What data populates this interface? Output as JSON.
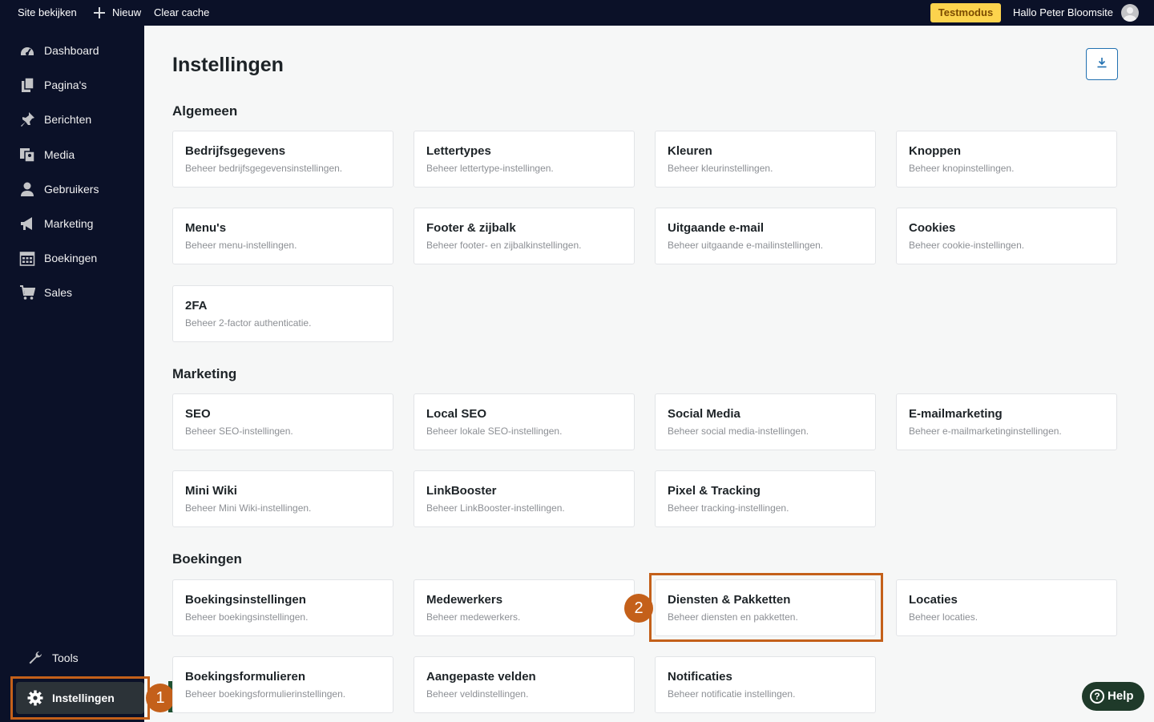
{
  "topbar": {
    "view_site": "Site bekijken",
    "new_label": "Nieuw",
    "clear_cache": "Clear cache",
    "test_mode": "Testmodus",
    "greeting": "Hallo Peter Bloomsite"
  },
  "sidebar": {
    "items": [
      {
        "label": "Dashboard",
        "icon": "dashboard-icon"
      },
      {
        "label": "Pagina's",
        "icon": "pages-icon"
      },
      {
        "label": "Berichten",
        "icon": "pin-icon"
      },
      {
        "label": "Media",
        "icon": "media-icon"
      },
      {
        "label": "Gebruikers",
        "icon": "user-icon"
      },
      {
        "label": "Marketing",
        "icon": "megaphone-icon"
      },
      {
        "label": "Boekingen",
        "icon": "calendar-icon"
      },
      {
        "label": "Sales",
        "icon": "cart-icon"
      }
    ],
    "tools": "Tools",
    "settings": "Instellingen"
  },
  "page": {
    "title": "Instellingen",
    "sections": [
      {
        "title": "Algemeen",
        "cards": [
          {
            "title": "Bedrijfsgegevens",
            "desc": "Beheer bedrijfsgegevensinstellingen."
          },
          {
            "title": "Lettertypes",
            "desc": "Beheer lettertype-instellingen."
          },
          {
            "title": "Kleuren",
            "desc": "Beheer kleurinstellingen."
          },
          {
            "title": "Knoppen",
            "desc": "Beheer knopinstellingen."
          },
          {
            "title": "Menu's",
            "desc": "Beheer menu-instellingen."
          },
          {
            "title": "Footer & zijbalk",
            "desc": "Beheer footer- en zijbalkinstellingen."
          },
          {
            "title": "Uitgaande e-mail",
            "desc": "Beheer uitgaande e-mailinstellingen."
          },
          {
            "title": "Cookies",
            "desc": "Beheer cookie-instellingen."
          },
          {
            "title": "2FA",
            "desc": "Beheer 2-factor authenticatie."
          }
        ]
      },
      {
        "title": "Marketing",
        "cards": [
          {
            "title": "SEO",
            "desc": "Beheer SEO-instellingen."
          },
          {
            "title": "Local SEO",
            "desc": "Beheer lokale SEO-instellingen."
          },
          {
            "title": "Social Media",
            "desc": "Beheer social media-instellingen."
          },
          {
            "title": "E-mailmarketing",
            "desc": "Beheer e-mailmarketinginstellingen."
          },
          {
            "title": "Mini Wiki",
            "desc": "Beheer Mini Wiki-instellingen."
          },
          {
            "title": "LinkBooster",
            "desc": "Beheer LinkBooster-instellingen."
          },
          {
            "title": "Pixel & Tracking",
            "desc": "Beheer tracking-instellingen."
          }
        ]
      },
      {
        "title": "Boekingen",
        "cards": [
          {
            "title": "Boekingsinstellingen",
            "desc": "Beheer boekingsinstellingen."
          },
          {
            "title": "Medewerkers",
            "desc": "Beheer medewerkers."
          },
          {
            "title": "Diensten & Pakketten",
            "desc": "Beheer diensten en pakketten."
          },
          {
            "title": "Locaties",
            "desc": "Beheer locaties."
          },
          {
            "title": "Boekingsformulieren",
            "desc": "Beheer boekingsformulierinstellingen."
          },
          {
            "title": "Aangepaste velden",
            "desc": "Beheer veldinstellingen."
          },
          {
            "title": "Notificaties",
            "desc": "Beheer notificatie instellingen."
          }
        ]
      }
    ]
  },
  "annotations": {
    "step1": "1",
    "step2": "2"
  },
  "help": "Help",
  "colors": {
    "sidebar_bg": "#0b1128",
    "accent": "#c4601a",
    "test_badge": "#fcd34d"
  }
}
